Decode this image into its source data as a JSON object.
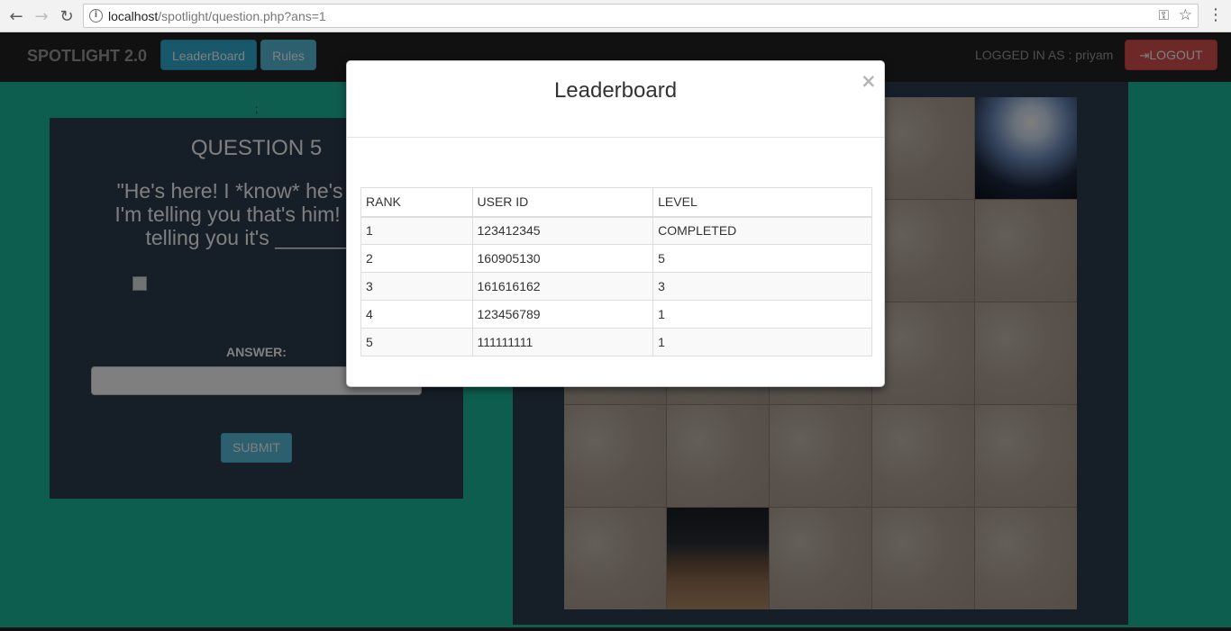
{
  "browser": {
    "url_host": "localhost",
    "url_path": "/spotlight/question.php?ans=1"
  },
  "navbar": {
    "brand": "SPOTLIGHT 2.0",
    "leaderboard_label": "LeaderBoard",
    "rules_label": "Rules",
    "logged_in_text": "LOGGED IN AS : priyam",
    "logout_label": "LOGOUT"
  },
  "question": {
    "marker": ";",
    "title": "QUESTION 5",
    "line1": "\"He's here! I *know* he's here!",
    "line2": "I'm telling you that's him! You h",
    "line3": "telling you it's ________",
    "answer_label": "ANSWER:",
    "answer_value": "",
    "submit_label": "SUBMIT"
  },
  "modal": {
    "title": "Leaderboard",
    "close": "×",
    "columns": [
      "RANK",
      "USER ID",
      "LEVEL"
    ],
    "rows": [
      {
        "rank": "1",
        "user_id": "123412345",
        "level": "COMPLETED"
      },
      {
        "rank": "2",
        "user_id": "160905130",
        "level": "5"
      },
      {
        "rank": "3",
        "user_id": "161616162",
        "level": "3"
      },
      {
        "rank": "4",
        "user_id": "123456789",
        "level": "1"
      },
      {
        "rank": "5",
        "user_id": "111111111",
        "level": "1"
      }
    ]
  },
  "icons": {
    "back": "back-arrow-icon",
    "forward": "forward-arrow-icon",
    "reload": "reload-icon",
    "info": "info-icon",
    "key": "key-icon",
    "star": "star-icon",
    "menu": "kebab-menu-icon",
    "logout": "sign-out-icon"
  },
  "colors": {
    "page_bg": "#1abc9c",
    "panel_bg": "#2c3e50",
    "navbar_bg": "#222222",
    "leaderboard_btn": "#31b0d5",
    "rules_btn": "#5bc0de",
    "logout_btn": "#d9534f"
  }
}
